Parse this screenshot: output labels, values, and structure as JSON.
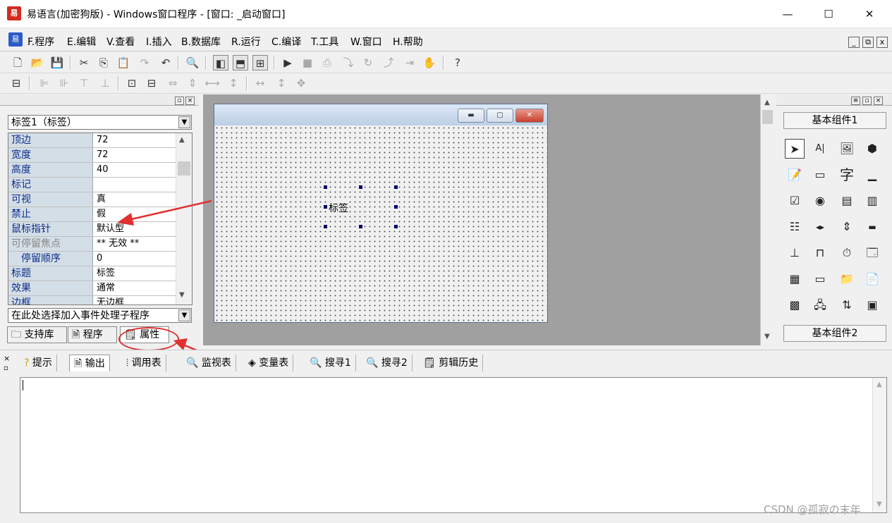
{
  "titlebar": {
    "app_icon": "易",
    "title": "易语言(加密狗版) - Windows窗口程序 - [窗口: _启动窗口]",
    "minimize": "—",
    "maximize": "☐",
    "close": "✕"
  },
  "menubar": {
    "icon": "易",
    "items": [
      "F.程序",
      "E.编辑",
      "V.查看",
      "I.插入",
      "B.数据库",
      "R.运行",
      "C.编译",
      "T.工具",
      "W.窗口",
      "H.帮助"
    ],
    "mdi_buttons": [
      "_",
      "⧉",
      "x"
    ]
  },
  "properties_panel": {
    "object_select": "标签1（标签）",
    "rows": [
      {
        "name": "顶边",
        "value": "72"
      },
      {
        "name": "宽度",
        "value": "72"
      },
      {
        "name": "高度",
        "value": "40"
      },
      {
        "name": "标记",
        "value": ""
      },
      {
        "name": "可视",
        "value": "真"
      },
      {
        "name": "禁止",
        "value": "假"
      },
      {
        "name": "鼠标指针",
        "value": "默认型"
      },
      {
        "name": "可停留焦点",
        "value": "** 无效 **"
      },
      {
        "name": "停留顺序",
        "value": "0"
      },
      {
        "name": "标题",
        "value": "标签"
      },
      {
        "name": "效果",
        "value": "通常"
      },
      {
        "name": "边框",
        "value": "无边框"
      }
    ],
    "event_select": "在此处选择加入事件处理子程序",
    "tabs": [
      "支持库",
      "程序",
      "属性"
    ]
  },
  "form_designer": {
    "label_text": "标签"
  },
  "components_panel": {
    "group1": "基本组件1",
    "group2": "基本组件2"
  },
  "output_panel": {
    "tabs": [
      "提示",
      "输出",
      "调用表",
      "监视表",
      "变量表",
      "搜寻1",
      "搜寻2",
      "剪辑历史"
    ]
  },
  "watermark": "CSDN @孤寂の末年"
}
